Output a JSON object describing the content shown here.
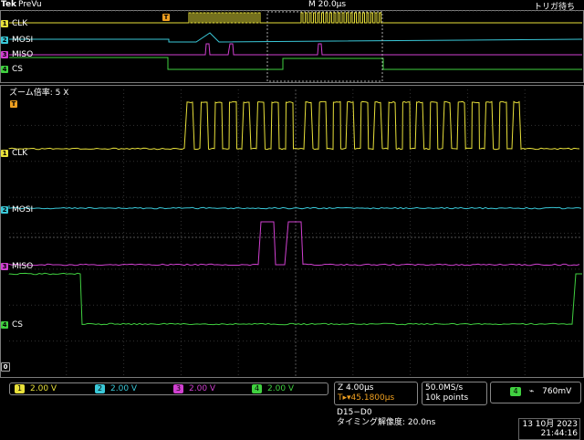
{
  "header": {
    "brand": "Tek",
    "mode": "PreVu",
    "timebase": "M 20.0μs",
    "trigger_status": "トリガ待ち"
  },
  "zoom": {
    "label": "ズーム倍率: 5 X"
  },
  "channels": [
    {
      "num": "1",
      "name": "CLK",
      "color": "#e8e03a",
      "scale": "2.00 V"
    },
    {
      "num": "2",
      "name": "MOSI",
      "color": "#3ac8d8",
      "scale": "2.00 V"
    },
    {
      "num": "3",
      "name": "MISO",
      "color": "#d040d0",
      "scale": "2.00 V"
    },
    {
      "num": "4",
      "name": "CS",
      "color": "#40d040",
      "scale": "2.00 V"
    }
  ],
  "markers": {
    "trigger": "T",
    "ref": "0"
  },
  "timing": {
    "zoom_scale": "Z 4.00μs",
    "position": "T▸▾45.1800μs"
  },
  "acquisition": {
    "sample_rate": "50.0MS/s",
    "record_length": "10k points"
  },
  "trigger": {
    "channel": "4",
    "slope_icon": "falling-edge-icon",
    "slope_glyph": "⌁",
    "level": "760mV"
  },
  "bus": {
    "name": "D15−D0",
    "resolution": "タイミング解像度: 20.0ns"
  },
  "datetime": {
    "date": "13 10月 2023",
    "time": "21:44:16"
  }
}
